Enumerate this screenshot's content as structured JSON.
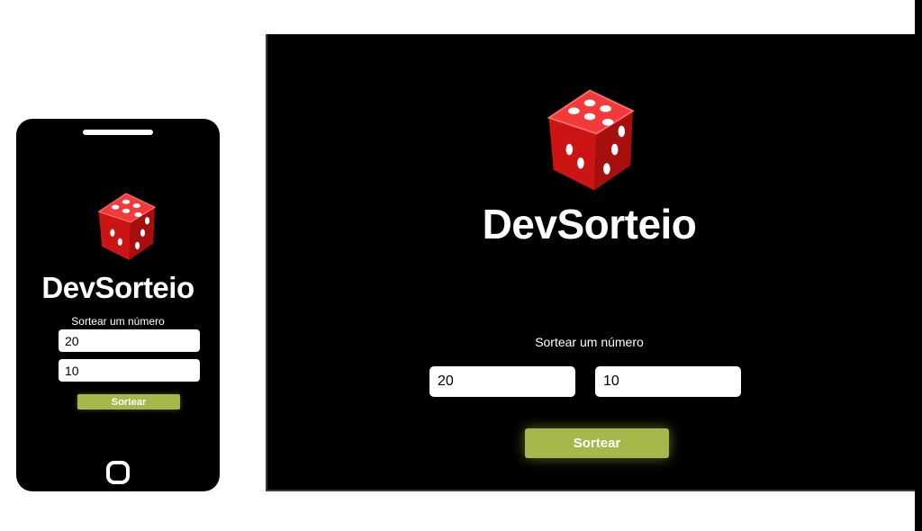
{
  "app": {
    "title": "DevSorteio",
    "logo_icon": "dice-icon",
    "accent_color": "#a6b84a",
    "background_color": "#000000"
  },
  "mobile": {
    "title": "DevSorteio",
    "label": "Sortear um número",
    "inputs": [
      {
        "value": "20"
      },
      {
        "value": "10"
      }
    ],
    "button_label": "Sortear"
  },
  "desktop": {
    "title": "DevSorteio",
    "label": "Sortear um número",
    "inputs": [
      {
        "value": "20"
      },
      {
        "value": "10"
      }
    ],
    "button_label": "Sortear"
  }
}
